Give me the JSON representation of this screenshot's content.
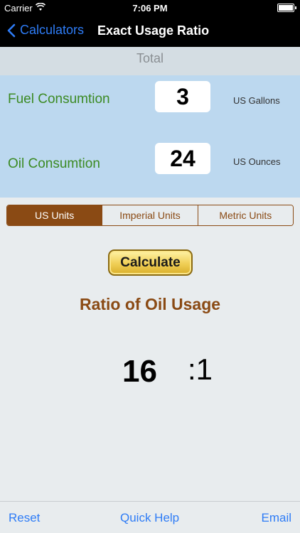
{
  "status_bar": {
    "carrier": "Carrier",
    "time": "7:06 PM"
  },
  "nav": {
    "back_label": "Calculators",
    "title": "Exact Usage Ratio"
  },
  "total_header": "Total",
  "inputs": {
    "fuel": {
      "label": "Fuel Consumtion",
      "value": "3",
      "unit": "US Gallons"
    },
    "oil": {
      "label": "Oil Consumtion",
      "value": "24",
      "unit": "US Ounces"
    }
  },
  "units_segment": {
    "options": [
      "US Units",
      "Imperial Units",
      "Metric Units"
    ],
    "selected": "US Units"
  },
  "calculate_label": "Calculate",
  "result": {
    "title": "Ratio of Oil Usage",
    "value": "16",
    "suffix": ":1"
  },
  "toolbar": {
    "reset": "Reset",
    "quick_help": "Quick Help",
    "email": "Email"
  },
  "colors": {
    "accent_blue": "#2e7cf6",
    "label_green": "#3b8a23",
    "brown": "#8a4a14",
    "panel_blue": "#bcd8ef",
    "button_gold": "#f0cf56"
  }
}
